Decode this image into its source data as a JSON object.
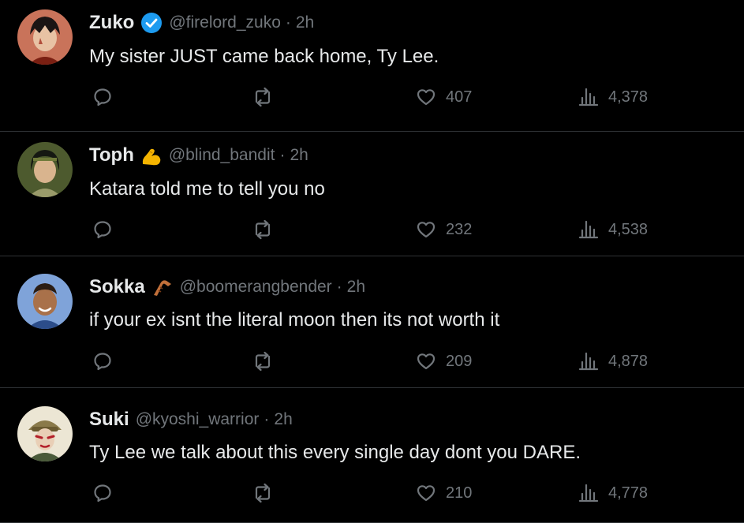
{
  "tweets": [
    {
      "name": "Zuko",
      "badge": "verified-badge",
      "handle": "@firelord_zuko",
      "separator": "·",
      "time": "2h",
      "text": "My sister JUST came back home, Ty Lee.",
      "likes": "407",
      "views": "4,378"
    },
    {
      "name": "Toph",
      "badge": "flexed-biceps-emoji",
      "handle": "@blind_bandit",
      "separator": "·",
      "time": "2h",
      "text": "Katara told me to tell you no",
      "likes": "232",
      "views": "4,538"
    },
    {
      "name": "Sokka",
      "badge": "boomerang-emoji",
      "handle": "@boomerangbender",
      "separator": "·",
      "time": "2h",
      "text": "if your ex isnt the literal moon then its not worth it",
      "likes": "209",
      "views": "4,878"
    },
    {
      "name": "Suki",
      "handle": "@kyoshi_warrior",
      "separator": "·",
      "time": "2h",
      "text": "Ty Lee we talk about this every single day dont you DARE.",
      "likes": "210",
      "views": "4,778"
    }
  ],
  "icons": {
    "reply": "reply-icon",
    "retweet": "retweet-icon",
    "like": "heart-icon",
    "views": "views-icon"
  },
  "colors": {
    "background": "#000000",
    "text": "#e7e9ea",
    "muted": "#71767b",
    "divider": "#2f3336",
    "verified": "#1d9bf0"
  }
}
